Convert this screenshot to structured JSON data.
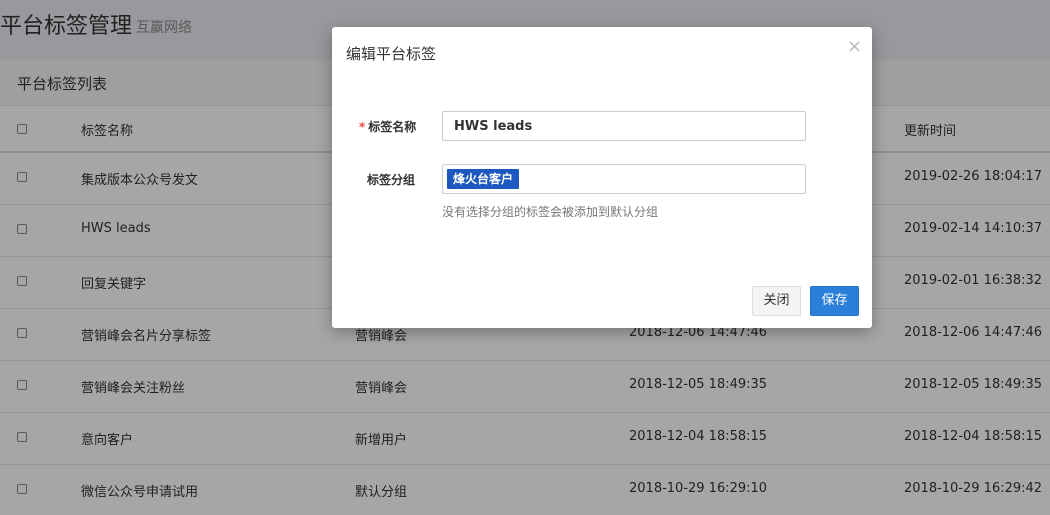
{
  "page": {
    "title": "平台标签管理",
    "subtitle": "互赢网络"
  },
  "panel": {
    "title": "平台标签列表"
  },
  "table": {
    "headers": [
      "标签名称",
      "",
      "",
      "更新时间"
    ],
    "rows": [
      {
        "name": "集成版本公众号发文",
        "group": "",
        "created": "",
        "updated": "2019-02-26 18:04:17"
      },
      {
        "name": "HWS leads",
        "group": "",
        "created": "",
        "updated": "2019-02-14 14:10:37"
      },
      {
        "name": "回复关键字",
        "group": "",
        "created": "",
        "updated": "2019-02-01 16:38:32"
      },
      {
        "name": "营销峰会名片分享标签",
        "group": "营销峰会",
        "created": "2018-12-06 14:47:46",
        "updated": "2018-12-06 14:47:46"
      },
      {
        "name": "营销峰会关注粉丝",
        "group": "营销峰会",
        "created": "2018-12-05 18:49:35",
        "updated": "2018-12-05 18:49:35"
      },
      {
        "name": "意向客户",
        "group": "新增用户",
        "created": "2018-12-04 18:58:15",
        "updated": "2018-12-04 18:58:15"
      },
      {
        "name": "微信公众号申请试用",
        "group": "默认分组",
        "created": "2018-10-29 16:29:10",
        "updated": "2018-10-29 16:29:42"
      }
    ]
  },
  "modal": {
    "title": "编辑平台标签",
    "close_icon": "×",
    "required_mark": "*",
    "name_label": "标签名称",
    "name_value": "HWS leads",
    "group_label": "标签分组",
    "group_tag": "烽火台客户",
    "help_text": "没有选择分组的标签会被添加到默认分组",
    "close_button": "关闭",
    "save_button": "保存"
  },
  "colors": {
    "primary": "#2b7fd8",
    "tag": "#1c58c0",
    "required": "#e74c3c"
  }
}
